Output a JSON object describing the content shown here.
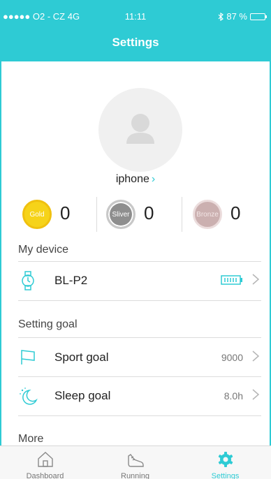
{
  "status_bar": {
    "carrier": "●●●●● O2 - CZ  4G",
    "time": "11:11",
    "battery": "87 %",
    "battery_level": 0.87
  },
  "header": {
    "title": "Settings"
  },
  "profile": {
    "name": "iphone",
    "chevron": "›"
  },
  "medals": [
    {
      "label": "Gold",
      "count": "0"
    },
    {
      "label": "Sliver",
      "count": "0"
    },
    {
      "label": "Bronze",
      "count": "0"
    }
  ],
  "device_section": {
    "title": "My device",
    "device_name": "BL-P2",
    "battery_level": 1.0
  },
  "goal_section": {
    "title": "Setting goal",
    "sport": {
      "label": "Sport goal",
      "value": "9000"
    },
    "sleep": {
      "label": "Sleep goal",
      "value": "8.0h"
    }
  },
  "more_section": {
    "title": "More"
  },
  "tabs": [
    {
      "label": "Dashboard",
      "icon": "home-icon",
      "active": false
    },
    {
      "label": "Running",
      "icon": "shoe-icon",
      "active": false
    },
    {
      "label": "Settings",
      "icon": "gear-icon",
      "active": true
    }
  ],
  "colors": {
    "accent": "#2ecbd4",
    "gold": "#f6d319",
    "silver": "#8e8e8e",
    "bronze": "#cbb0b0"
  }
}
